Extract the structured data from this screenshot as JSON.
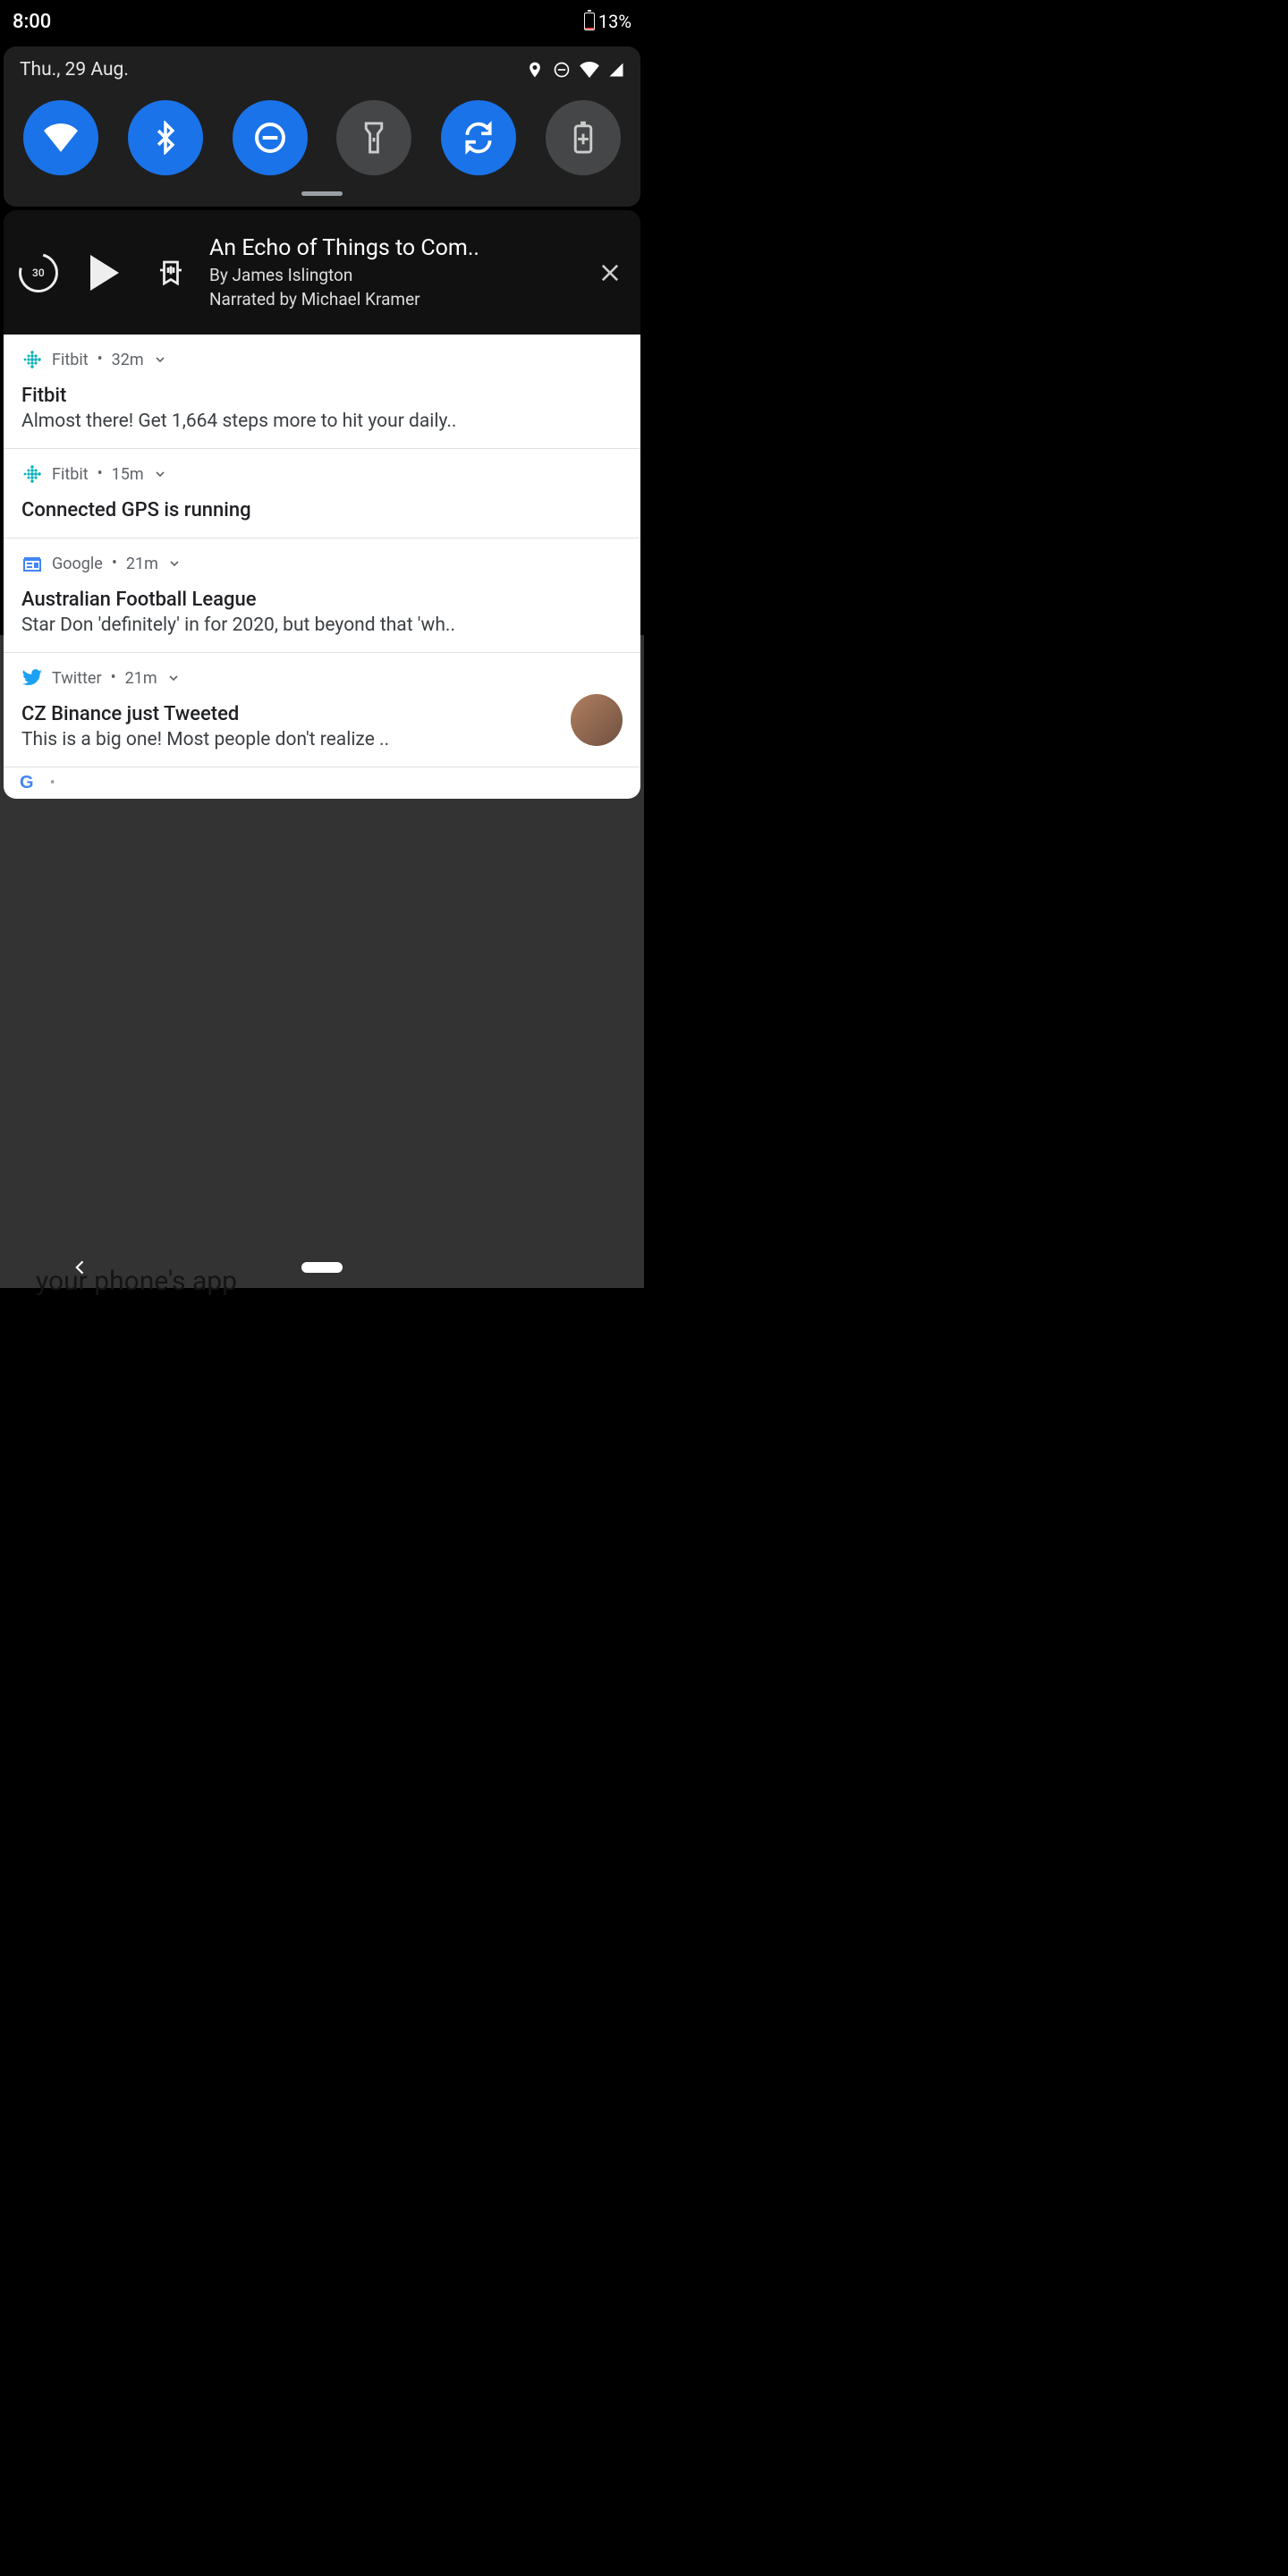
{
  "status": {
    "time": "8:00",
    "battery_pct": "13%"
  },
  "qs": {
    "date": "Thu., 29 Aug.",
    "toggles": [
      {
        "name": "wifi",
        "on": true
      },
      {
        "name": "bluetooth",
        "on": true
      },
      {
        "name": "dnd",
        "on": true
      },
      {
        "name": "flashlight",
        "on": false
      },
      {
        "name": "autorotate",
        "on": true
      },
      {
        "name": "battery-saver",
        "on": false
      }
    ]
  },
  "media": {
    "title": "An Echo of Things to Com..",
    "author": "By James Islington",
    "narrator": "Narrated by Michael Kramer",
    "replay_seconds": "30"
  },
  "notifications": [
    {
      "app": "Fitbit",
      "time": "32m",
      "title": "Fitbit",
      "text": "Almost there! Get 1,664 steps more to hit your daily..",
      "icon": "fitbit"
    },
    {
      "app": "Fitbit",
      "time": "15m",
      "title": "Connected GPS is running",
      "text": "",
      "icon": "fitbit"
    },
    {
      "app": "Google",
      "time": "21m",
      "title": "Australian Football League",
      "text": "Star Don 'definitely' in for 2020, but beyond that 'wh..",
      "icon": "google-news"
    },
    {
      "app": "Twitter",
      "time": "21m",
      "title": "CZ Binance just Tweeted",
      "text": "This is a big one!  Most people don't realize ..",
      "icon": "twitter",
      "avatar": true
    }
  ],
  "bg_text": "your phone's app"
}
